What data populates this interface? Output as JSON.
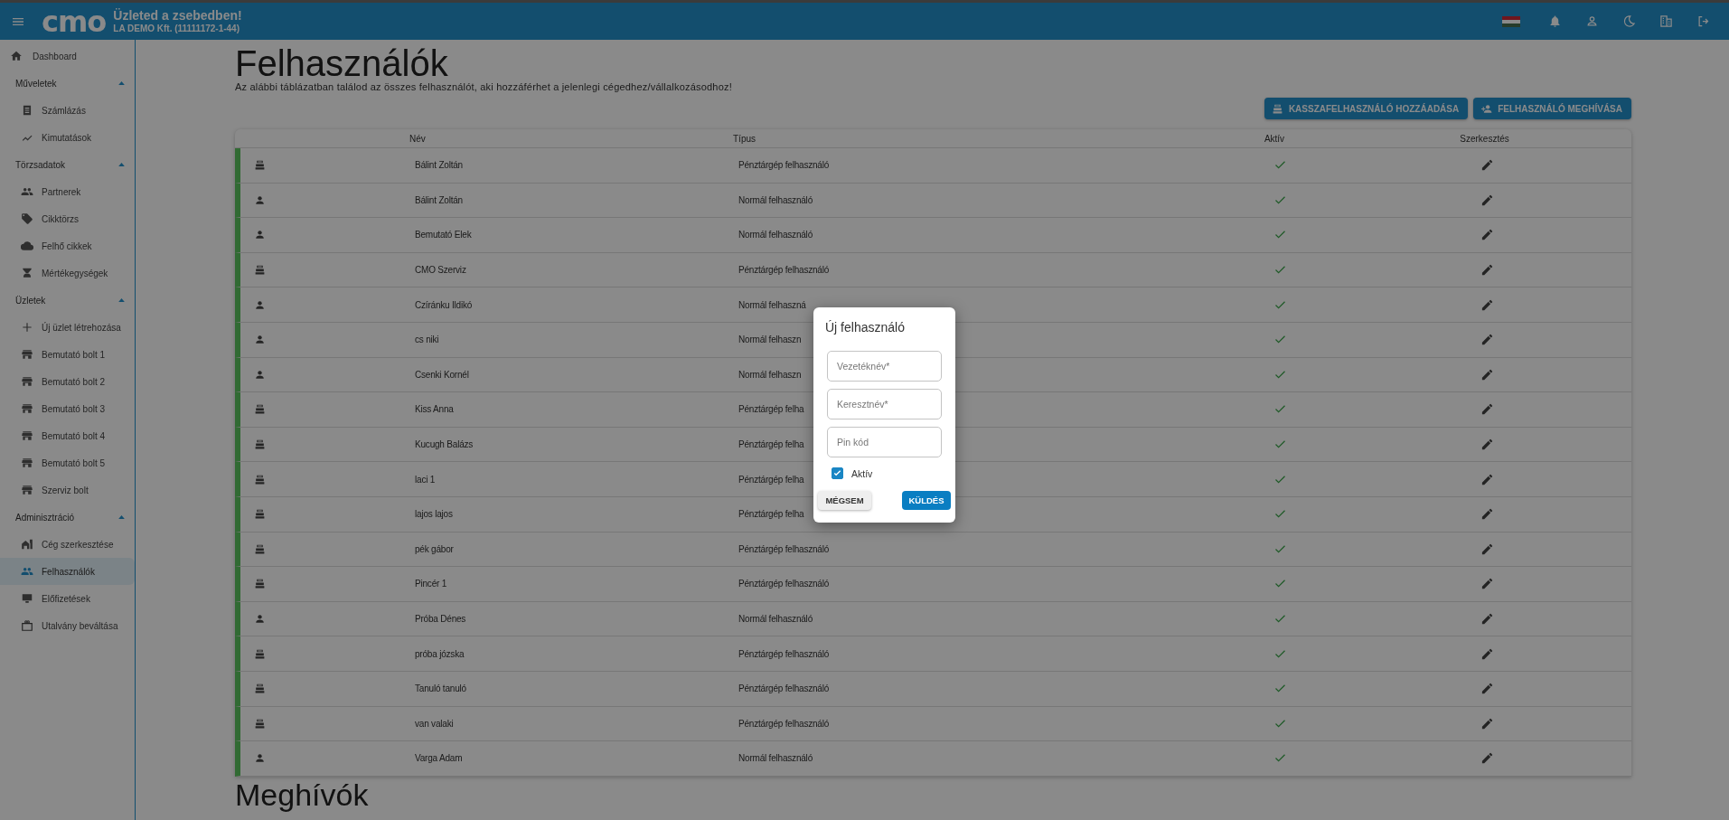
{
  "app_bar": {
    "logo": "cmo",
    "slogan": "Üzleted a zsebedben!",
    "company": "LA DEMO Kft. (11111172-1-44)"
  },
  "sidebar": {
    "items": [
      {
        "kind": "link",
        "label": "Dashboard",
        "selected": false
      },
      {
        "kind": "section",
        "label": "Műveletek",
        "expanded": true,
        "children": [
          {
            "label": "Számlázás",
            "selected": false
          },
          {
            "label": "Kimutatások",
            "selected": false
          }
        ]
      },
      {
        "kind": "section",
        "label": "Törzsadatok",
        "expanded": true,
        "children": [
          {
            "label": "Partnerek",
            "selected": false
          },
          {
            "label": "Cikktörzs",
            "selected": false
          },
          {
            "label": "Felhő cikkek",
            "selected": false
          },
          {
            "label": "Mértékegységek",
            "selected": false
          }
        ]
      },
      {
        "kind": "section",
        "label": "Üzletek",
        "expanded": true,
        "children": [
          {
            "label": "Új üzlet létrehozása",
            "selected": false
          },
          {
            "label": "Bemutató bolt 1",
            "selected": false
          },
          {
            "label": "Bemutató bolt 2",
            "selected": false
          },
          {
            "label": "Bemutató bolt 3",
            "selected": false
          },
          {
            "label": "Bemutató bolt 4",
            "selected": false
          },
          {
            "label": "Bemutató bolt 5",
            "selected": false
          },
          {
            "label": "Szerviz bolt",
            "selected": false
          }
        ]
      },
      {
        "kind": "section",
        "label": "Adminisztráció",
        "expanded": true,
        "children": [
          {
            "label": "Cég szerkesztése",
            "selected": false
          },
          {
            "label": "Felhasználók",
            "selected": true
          },
          {
            "label": "Előfizetések",
            "selected": false
          },
          {
            "label": "Utalvány beváltása",
            "selected": false
          }
        ]
      }
    ]
  },
  "page": {
    "title": "Felhasználók",
    "description": "Az alábbi táblázatban találod az összes felhasználót, aki hozzáférhet a jelenlegi cégedhez/vállalkozásodhoz!",
    "buttons": [
      {
        "kind": "cashier",
        "label": "KASSZAFELHASZNÁLÓ HOZZÁADÁSA"
      },
      {
        "kind": "invite",
        "label": "FELHASZNÁLÓ MEGHÍVÁSA"
      }
    ],
    "table": {
      "columns": [
        "Név",
        "Típus",
        "Aktív",
        "Szerkesztés"
      ],
      "rows": [
        {
          "kind": "cashier",
          "name": "Bálint Zoltán",
          "type": "Pénztárgép felhasználó",
          "active": true
        },
        {
          "kind": "normal",
          "name": "Bálint Zoltán",
          "type": "Normál felhasználó",
          "active": true
        },
        {
          "kind": "normal",
          "name": "Bemutató Elek",
          "type": "Normál felhasználó",
          "active": true
        },
        {
          "kind": "cashier",
          "name": "CMO Szerviz",
          "type": "Pénztárgép felhasználó",
          "active": true
        },
        {
          "kind": "normal",
          "name": "Czíránku Ildikó",
          "type": "Normál felhaszná",
          "active": true
        },
        {
          "kind": "normal",
          "name": "cs niki",
          "type": "Normál felhaszn",
          "active": true
        },
        {
          "kind": "normal",
          "name": "Csenki Kornél",
          "type": "Normál felhaszn",
          "active": true
        },
        {
          "kind": "cashier",
          "name": "Kiss Anna",
          "type": "Pénztárgép felha",
          "active": true
        },
        {
          "kind": "cashier",
          "name": "Kucugh Balázs",
          "type": "Pénztárgép felha",
          "active": true
        },
        {
          "kind": "cashier",
          "name": "laci 1",
          "type": "Pénztárgép felha",
          "active": true
        },
        {
          "kind": "cashier",
          "name": "lajos lajos",
          "type": "Pénztárgép felha",
          "active": true
        },
        {
          "kind": "cashier",
          "name": "pék gábor",
          "type": "Pénztárgép felhasználó",
          "active": true
        },
        {
          "kind": "cashier",
          "name": "Pincér 1",
          "type": "Pénztárgép felhasználó",
          "active": true
        },
        {
          "kind": "normal",
          "name": "Próba Dénes",
          "type": "Normál felhasználó",
          "active": true
        },
        {
          "kind": "cashier",
          "name": "próba józska",
          "type": "Pénztárgép felhasználó",
          "active": true
        },
        {
          "kind": "cashier",
          "name": "Tanuló tanuló",
          "type": "Pénztárgép felhasználó",
          "active": true
        },
        {
          "kind": "cashier",
          "name": "van valaki",
          "type": "Pénztárgép felhasználó",
          "active": true
        },
        {
          "kind": "normal",
          "name": "Varga Adam",
          "type": "Normál felhasználó",
          "active": true
        }
      ]
    },
    "invites_title": "Meghívók"
  },
  "dialog": {
    "title": "Új felhasználó",
    "fields": [
      {
        "placeholder": "Vezetéknév*"
      },
      {
        "placeholder": "Keresztnév*"
      },
      {
        "placeholder": "Pin kód"
      }
    ],
    "checkbox": {
      "label": "Aktív",
      "checked": true
    },
    "cancel": "MÉGSEM",
    "submit": "KÜLDÉS"
  }
}
